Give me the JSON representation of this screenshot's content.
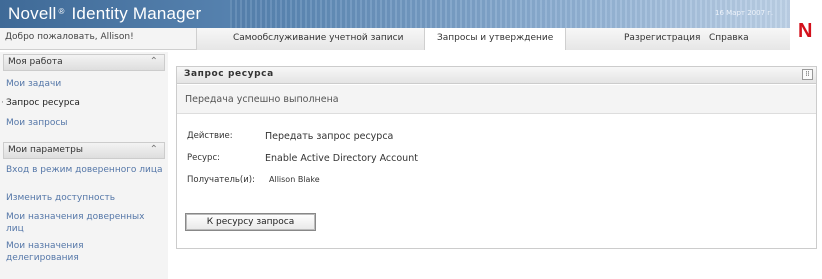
{
  "brand": {
    "part1": "Novell",
    "registered": "®",
    "part2": "Identity Manager",
    "date": "16 Март 2007 г."
  },
  "header": {
    "welcome": "Добро пожаловать, Allison!",
    "tabs": [
      {
        "label": "Самообслуживание учетной записи",
        "active": false
      },
      {
        "label": "Запросы и утверждение",
        "active": true
      },
      {
        "label": "Разрегистрация",
        "active": false
      },
      {
        "label": "Справка",
        "active": false
      }
    ]
  },
  "sidebar": {
    "section1": {
      "title": "Моя работа",
      "items": [
        {
          "label": "Мои задачи",
          "current": false
        },
        {
          "label": "Запрос ресурса",
          "current": true
        },
        {
          "label": "Мои запросы",
          "current": false
        }
      ]
    },
    "section2": {
      "title": "Мои параметры",
      "items": [
        {
          "label": "Вход в режим доверенного лица"
        },
        {
          "label": "Изменить доступность"
        },
        {
          "label": "Мои назначения доверенных лиц"
        },
        {
          "label": "Мои назначения делегирования"
        }
      ]
    }
  },
  "panel": {
    "title": "Запрос ресурса",
    "success_message": "Передача успешно выполнена",
    "fields": [
      {
        "label": "Действие:",
        "value": "Передать запрос ресурса"
      },
      {
        "label": "Ресурс:",
        "value": "Enable Active Directory Account"
      },
      {
        "label": "Получатель(и):",
        "value": "Allison Blake"
      }
    ],
    "button_label": "К ресурсу запроса"
  },
  "colors": {
    "banner_dark": "#3f6a97",
    "link": "#5577a8",
    "logo_red": "#d3101b"
  }
}
